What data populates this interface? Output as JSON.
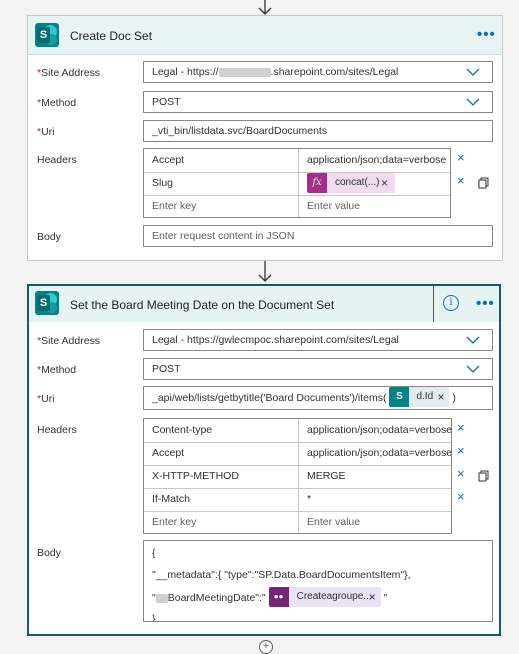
{
  "card1": {
    "title": "Create Doc Set",
    "more_label": "•••",
    "site_label": "Site Address",
    "site_value_prefix": "Legal - https://",
    "site_value_suffix": ".sharepoint.com/sites/Legal",
    "method_label": "Method",
    "method_value": "POST",
    "uri_label": "Uri",
    "uri_value": "_vti_bin/listdata.svc/BoardDocuments",
    "headers_label": "Headers",
    "headers": [
      {
        "key": "Accept",
        "value": "application/json;data=verbose"
      },
      {
        "key": "Slug",
        "value": ""
      }
    ],
    "slug_token": "concat(...)",
    "key_placeholder": "Enter key",
    "value_placeholder": "Enter value",
    "body_label": "Body",
    "body_placeholder": "Enter request content in JSON"
  },
  "card2": {
    "title": "Set the Board Meeting Date on the Document Set",
    "info_label": "i",
    "more_label": "•••",
    "site_label": "Site Address",
    "site_value": "Legal - https://gwlecmpoc.sharepoint.com/sites/Legal",
    "method_label": "Method",
    "method_value": "POST",
    "uri_label": "Uri",
    "uri_value": "_api/web/lists/getbytitle('Board Documents')/items(",
    "uri_token": "d.Id",
    "uri_close": ")",
    "headers_label": "Headers",
    "headers": [
      {
        "key": "Content-type",
        "value": "application/json;odata=verbose"
      },
      {
        "key": "Accept",
        "value": "application/json;odata=verbose"
      },
      {
        "key": "X-HTTP-METHOD",
        "value": "MERGE"
      },
      {
        "key": "If-Match",
        "value": "*"
      }
    ],
    "key_placeholder": "Enter key",
    "value_placeholder": "Enter value",
    "body_label": "Body",
    "body_line1": "{",
    "body_line2": "\"__metadata\":{ \"type\":\"SP.Data.BoardDocumentsItem\"},",
    "body_line3_prefix": "\"",
    "body_line3_mid": "BoardMeetingDate\":\"",
    "body_token": "Createagroupe...",
    "body_line3_suffix": "\"",
    "body_line4": "}"
  },
  "required_mark": "*",
  "remove_label": "×"
}
